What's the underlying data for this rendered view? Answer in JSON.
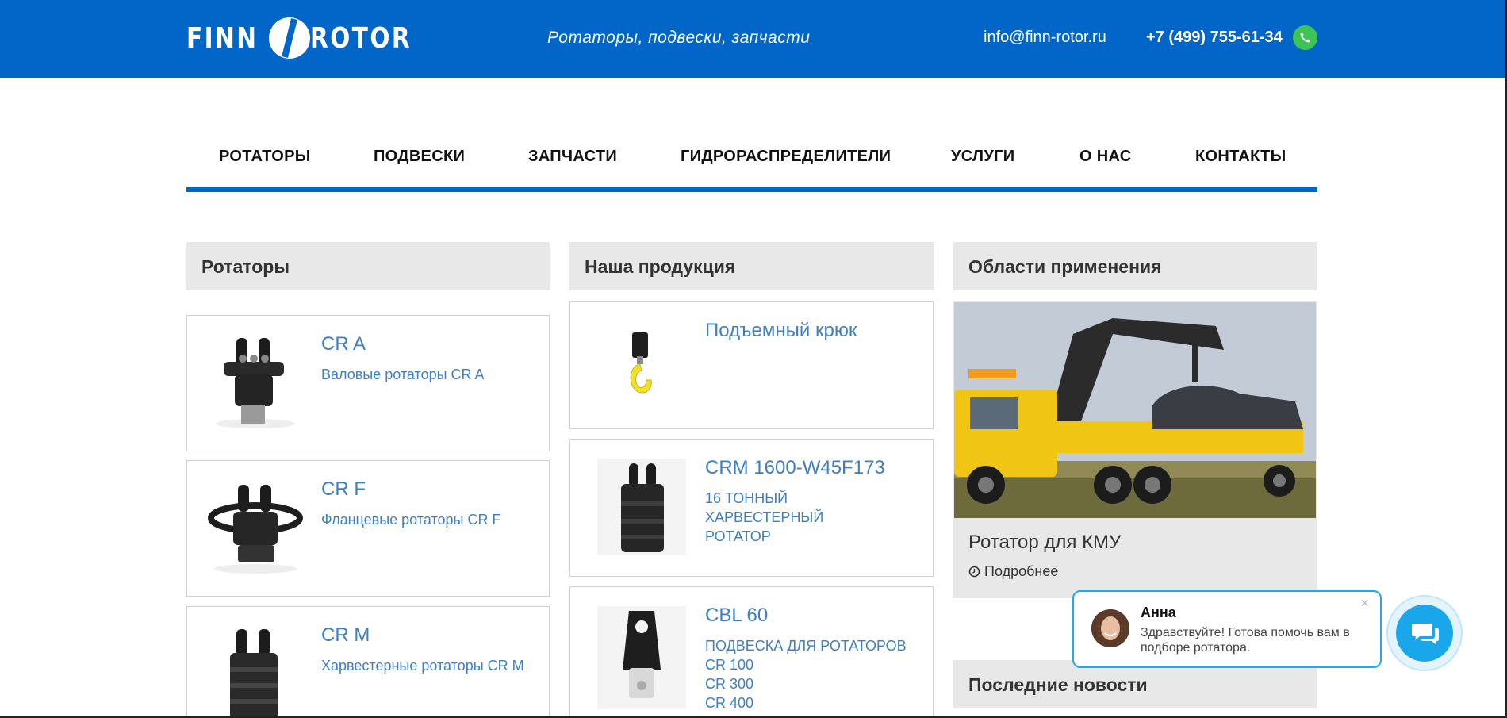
{
  "header": {
    "logo_left": "FINN",
    "logo_right": "ROTOR",
    "tagline": "Ротаторы, подвески, запчасти",
    "email": "info@finn-rotor.ru",
    "phone": "+7 (499) 755-61-34",
    "brand_color": "#0166c7"
  },
  "nav": {
    "items": [
      {
        "label": "РОТАТОРЫ"
      },
      {
        "label": "ПОДВЕСКИ"
      },
      {
        "label": "ЗАПЧАСТИ"
      },
      {
        "label": "ГИДРОРАСПРЕДЕЛИТЕЛИ"
      },
      {
        "label": "УСЛУГИ"
      },
      {
        "label": "О НАС"
      },
      {
        "label": "КОНТАКТЫ"
      }
    ]
  },
  "rotators": {
    "heading": "Ротаторы",
    "items": [
      {
        "title": "CR A",
        "desc": "Валовые ротаторы CR A"
      },
      {
        "title": "CR F",
        "desc": "Фланцевые ротаторы CR F"
      },
      {
        "title": "CR M",
        "desc": "Харвестерные ротаторы CR M"
      }
    ]
  },
  "products": {
    "heading": "Наша продукция",
    "items": [
      {
        "title": "Подъемный крюк",
        "lines": []
      },
      {
        "title": "CRM 1600-W45F173",
        "lines": [
          "16 ТОННЫЙ",
          "ХАРВЕСТЕРНЫЙ",
          "РОТАТОР"
        ]
      },
      {
        "title": "CBL 60",
        "lines": [
          "ПОДВЕСКА ДЛЯ РОТАТОРОВ",
          "CR 100",
          "CR 300",
          "CR 400"
        ]
      }
    ]
  },
  "areas": {
    "heading": "Области применения",
    "card_title": "Ротатор для КМУ",
    "more_label": "Подробнее",
    "icons": [
      "clock-icon"
    ]
  },
  "news": {
    "heading": "Последние новости"
  },
  "chat": {
    "agent_name": "Анна",
    "message": "Здравствуйте! Готова помочь вам в подборе ротатора.",
    "close_label": "×",
    "accent": "#19a6ea"
  }
}
